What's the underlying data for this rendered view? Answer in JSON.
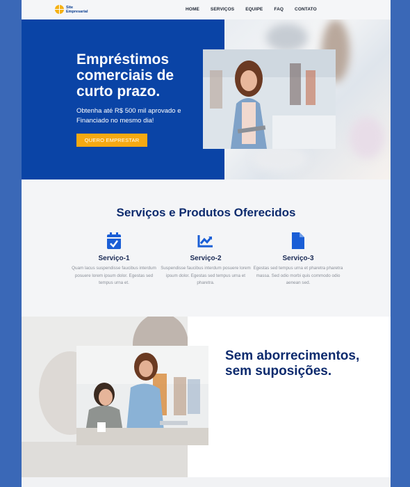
{
  "nav": {
    "logo_line1": "Site",
    "logo_line2": "Empresarial",
    "links": [
      "HOME",
      "SERVIÇOS",
      "EQUIPE",
      "FAQ",
      "CONTATO"
    ]
  },
  "hero": {
    "title": "Empréstimos comerciais de curto prazo.",
    "subtitle": "Obtenha até R$ 500 mil aprovado e Financiado no mesmo dia!",
    "cta": "QUERO EMPRESTAR"
  },
  "services": {
    "title": "Serviços e Produtos Oferecidos",
    "items": [
      {
        "icon": "calendar-check-icon",
        "name": "Serviço-1",
        "desc": "Quam lacus suspendisse faucibus interdum posuere lorem ipsum dolor. Egestas sed tempus urna et."
      },
      {
        "icon": "chart-line-icon",
        "name": "Serviço-2",
        "desc": "Suspendisse faucibus interdum posuere lorem ipsum dolor. Egestas sed tempus urna et pharetra."
      },
      {
        "icon": "file-icon",
        "name": "Serviço-3",
        "desc": "Egestas sed tempus urna et pharetra pharetra massa. Sed odio morbi quis commodo odio aenean sed."
      }
    ]
  },
  "why": {
    "title": "Sem aborrecimentos, sem suposições."
  },
  "colors": {
    "brand_blue": "#0a44a6",
    "accent_orange": "#f5a912",
    "heading_navy": "#0d2b6e",
    "icon_blue": "#1a5ed6",
    "frame_blue": "#3a68b7"
  }
}
